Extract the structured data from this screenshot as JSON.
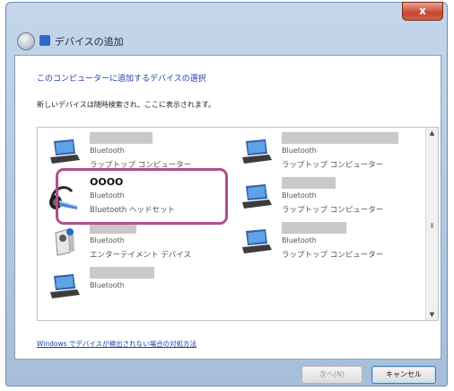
{
  "window": {
    "title": "デバイスの追加",
    "close_label": "x"
  },
  "content": {
    "heading": "このコンピューターに追加するデバイスの選択",
    "subtext": "新しいデバイスは随時検索され、ここに表示されます。"
  },
  "devices": [
    {
      "name": "",
      "type": "Bluetooth",
      "category": "ラップトップ コンピューター",
      "icon": "laptop-icon"
    },
    {
      "name": "",
      "type": "Bluetooth",
      "category": "ラップトップ コンピューター",
      "icon": "laptop-icon"
    },
    {
      "name": "OOOO",
      "type": "Bluetooth",
      "category": "Bluetooth ヘッドセット",
      "icon": "headset-icon"
    },
    {
      "name": "",
      "type": "Bluetooth",
      "category": "ラップトップ コンピューター",
      "icon": "laptop-icon"
    },
    {
      "name": "",
      "type": "Bluetooth",
      "category": "エンターテイメント デバイス",
      "icon": "entertainment-device-icon"
    },
    {
      "name": "",
      "type": "Bluetooth",
      "category": "ラップトップ コンピューター",
      "icon": "laptop-icon"
    },
    {
      "name": "",
      "type": "Bluetooth",
      "category": "",
      "icon": "laptop-icon"
    }
  ],
  "help_link": "Windows でデバイスが検出されない場合の対処方法",
  "buttons": {
    "next": "次へ(N)",
    "cancel": "キャンセル"
  }
}
